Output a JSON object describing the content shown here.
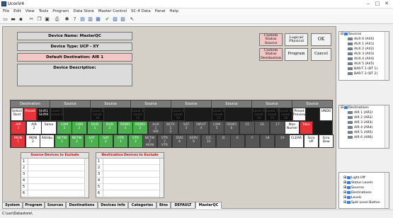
{
  "window": {
    "title": "UconV4"
  },
  "menu": [
    "File",
    "Edit",
    "View",
    "Tools",
    "Program",
    "Data Store",
    "Master Control",
    "SC-4 Data",
    "Panel",
    "Help"
  ],
  "panel": {
    "device_name": "Device Name: MasterQC",
    "device_type": "Device Type: UCP - XY",
    "default_destination": "Default Destination: AIR  1",
    "device_description": "Device Description:",
    "buttons": {
      "custom_status_source": "Custom Status Source",
      "logical_physical": "Logical/ Physical",
      "ok": "OK",
      "custom_status_destination": "Custom Status Destination",
      "program": "Program",
      "cancel": "Cancel"
    }
  },
  "grid": {
    "headers": [
      "Destination",
      "Source",
      "Source",
      "Source",
      "Source",
      "Source",
      "Source",
      "Source"
    ],
    "cells": [
      {
        "t": "Select\nDest",
        "bg": "#ffffff",
        "fg": "#000000"
      },
      {
        "t": "Preset",
        "bg": "#e8333a",
        "fg": "#ffffff"
      },
      {
        "t": "Shift1\nShift9",
        "bg": "#111111",
        "fg": "#ffffff"
      },
      {
        "t": "Level 1\nLevel 9",
        "bg": "#111111",
        "fg": "#555555"
      },
      {
        "t": "Level 2\nLevel 10",
        "bg": "#111111",
        "fg": "#555555"
      },
      {
        "t": "Level 3\nLevel 11",
        "bg": "#111111",
        "fg": "#555555"
      },
      {
        "t": "Level 4\nLevel 12",
        "bg": "#111111",
        "fg": "#555555"
      },
      {
        "t": "Level 5\nLevel 13",
        "bg": "#111111",
        "fg": "#555555"
      },
      {
        "t": "Level 6\nLevel 14",
        "bg": "#111111",
        "fg": "#555555"
      },
      {
        "t": "Level 7\nLevel 15",
        "bg": "#111111",
        "fg": "#555555"
      },
      {
        "t": "Level 8\nLevel 16",
        "bg": "#111111",
        "fg": "#555555"
      },
      {
        "t": "Preset\nPreview",
        "bg": "#ffffff",
        "fg": "#000000"
      },
      {
        "t": "UNDO",
        "bg": "#ffffff",
        "fg": "#000000"
      }
    ],
    "row2": [
      {
        "t": "AIR\n1",
        "bg": "#e8333a",
        "fg": "#ffffff"
      },
      {
        "t": "AIR\n2",
        "bg": "#ffffff",
        "fg": "#000000"
      },
      {
        "t": "Salvo",
        "bg": "#ffffff",
        "fg": "#000000"
      },
      {
        "t": "CAM\n1",
        "bg": "#4caf50",
        "fg": "#ffffff"
      },
      {
        "t": "CAM\n2",
        "bg": "#4caf50",
        "fg": "#ffffff"
      },
      {
        "t": "DVD\n1",
        "bg": "#4caf50",
        "fg": "#ffffff"
      },
      {
        "t": "DVD\n2",
        "bg": "#4caf50",
        "fg": "#ffffff"
      },
      {
        "t": "REMO\n1",
        "bg": "#4caf50",
        "fg": "#ffffff"
      },
      {
        "t": "REMO\n2",
        "bg": "#4caf50",
        "fg": "#ffffff"
      },
      {
        "t": "AUX\n1\nAIR",
        "bg": "#555555",
        "fg": "#dddddd"
      },
      {
        "t": "BETA\n1\n2",
        "bg": "#555555",
        "fg": "#dddddd"
      },
      {
        "t": "SAT\n3",
        "bg": "#555555",
        "fg": "#dddddd"
      },
      {
        "t": "INPUT\n4",
        "bg": "#555555",
        "fg": "#dddddd"
      },
      {
        "t": "CAM\n5",
        "bg": "#555555",
        "fg": "#dddddd"
      },
      {
        "t": "REMO\n6",
        "bg": "#555555",
        "fg": "#dddddd"
      },
      {
        "t": "15",
        "bg": "#555555",
        "fg": "#dddddd"
      },
      {
        "t": "16",
        "bg": "#555555",
        "fg": "#dddddd"
      },
      {
        "t": "17",
        "bg": "#555555",
        "fg": "#dddddd"
      },
      {
        "t": "Mon\nNumer",
        "bg": "#ffffff",
        "fg": "#000000"
      },
      {
        "t": "Take",
        "bg": "#e8333a",
        "fg": "#ffffff"
      }
    ],
    "row3": [
      {
        "t": "MON\n1",
        "bg": "#e8333a",
        "fg": "#ffffff"
      },
      {
        "t": "MON\n2",
        "bg": "#ffffff",
        "fg": "#000000"
      },
      {
        "t": "Attribu",
        "bg": "#ffffff",
        "fg": "#000000"
      },
      {
        "t": "NETW\n1",
        "bg": "#4caf50",
        "fg": "#ffffff"
      },
      {
        "t": "NETW\n2",
        "bg": "#4caf50",
        "fg": "#ffffff"
      },
      {
        "t": "SAT\n1",
        "bg": "#4caf50",
        "fg": "#ffffff"
      },
      {
        "t": "SAT\n2",
        "bg": "#4caf50",
        "fg": "#ffffff"
      },
      {
        "t": "VTR\n1",
        "bg": "#4caf50",
        "fg": "#ffffff"
      },
      {
        "t": "VTR\n2",
        "bg": "#4caf50",
        "fg": "#ffffff"
      },
      {
        "t": "NETW\n7\nMON",
        "bg": "#555555",
        "fg": "#dddddd"
      },
      {
        "t": "VTR\n7\nVTR",
        "bg": "#555555",
        "fg": "#dddddd"
      },
      {
        "t": "DVD\n8",
        "bg": "#555555",
        "fg": "#dddddd"
      },
      {
        "t": "SERV\n9",
        "bg": "#555555",
        "fg": "#dddddd"
      },
      {
        "t": "CG\n10",
        "bg": "#555555",
        "fg": "#dddddd"
      },
      {
        "t": "D",
        "bg": "#555555",
        "fg": "#dddddd"
      },
      {
        "t": "E",
        "bg": "#555555",
        "fg": "#dddddd"
      },
      {
        "t": "F",
        "bg": "#555555",
        "fg": "#dddddd"
      },
      {
        "t": "18",
        "bg": "#555555",
        "fg": "#dddddd"
      },
      {
        "t": "19",
        "bg": "#555555",
        "fg": "#dddddd"
      },
      {
        "t": "CLEAR",
        "bg": "#ffffff",
        "fg": "#000000"
      },
      {
        "t": "Scro\nUP",
        "bg": "#ffffff",
        "fg": "#000000"
      },
      {
        "t": "Scro\nDow",
        "bg": "#ffffff",
        "fg": "#000000"
      }
    ]
  },
  "lists": {
    "source_exclude": {
      "title": "Source Devices to Exclude",
      "rows": [
        "1",
        "2",
        "3",
        "4",
        "5",
        "6"
      ]
    },
    "dest_exclude": {
      "title": "Destination Devices to Exclude",
      "rows": [
        "1",
        "2",
        "3",
        "4",
        "5",
        "6"
      ]
    }
  },
  "tabs": [
    "System",
    "Program",
    "Sources",
    "Destinations",
    "Devices Info",
    "Categories",
    "Bins",
    "DEFAULT",
    "MasterQC"
  ],
  "active_tab": "MasterQC",
  "status": {
    "path": "C:\\usr\\Datastore\\"
  },
  "sources_tree": {
    "root": "Sources",
    "items": [
      "AUX  0  (AX0)",
      "AUX  1  (AX1)",
      "AUX  2  (AX2)",
      "AUX  3  (AX3)",
      "AUX  4  (AX4)",
      "AUX  5  (AX5)",
      "BAR-T  1  (BT 1)",
      "BAR-T  2  (BT 2)"
    ]
  },
  "dest_tree": {
    "root": "Destinations",
    "items": [
      "AIR  1  (AR1)",
      "AIR  2  (AR2)",
      "AIR  3  (AR3)",
      "AIR  4  (AR4)",
      "AIR  5  (AR5)",
      "AIR  6  (AR6)"
    ]
  },
  "misc_tree": {
    "items": [
      "Light Off",
      "Status Levels",
      "Sources",
      "Destinations",
      "Levels",
      "Split Level Button"
    ]
  }
}
